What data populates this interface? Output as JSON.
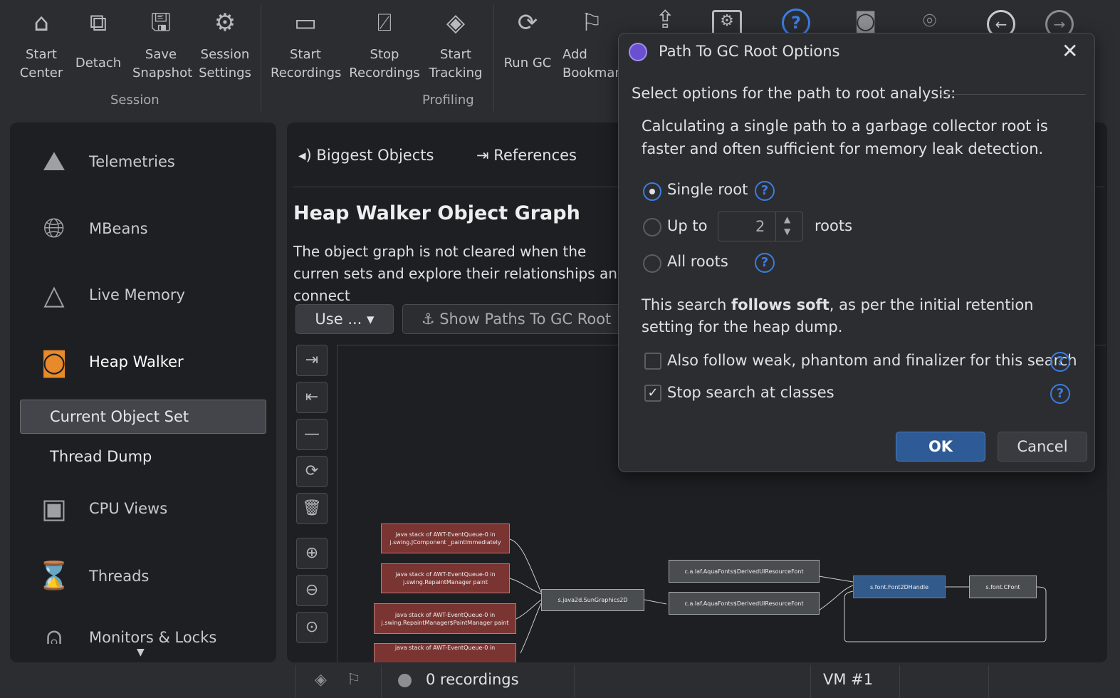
{
  "toolbar": {
    "items": [
      {
        "label": "Start\nCenter",
        "icon": "home-icon"
      },
      {
        "label": "Detach",
        "icon": "detach-icon"
      },
      {
        "label": "Save\nSnapshot",
        "icon": "save-icon"
      },
      {
        "label": "Session\nSettings",
        "icon": "gear-icon"
      },
      {
        "label": "Start\nRecordings",
        "icon": "video-icon"
      },
      {
        "label": "Stop\nRecordings",
        "icon": "video-off-icon"
      },
      {
        "label": "Start\nTracking",
        "icon": "tracking-icon"
      },
      {
        "label": "Run GC",
        "icon": "refresh-icon"
      },
      {
        "label": "Add\nBookmark",
        "icon": "bookmark-icon"
      }
    ],
    "groups": {
      "session": "Session",
      "profiling": "Profiling"
    }
  },
  "sidebar": {
    "items": [
      {
        "label": "Telemetries",
        "icon": "chart-icon"
      },
      {
        "label": "MBeans",
        "icon": "globe-icon"
      },
      {
        "label": "Live Memory",
        "icon": "shapes-icon"
      },
      {
        "label": "Heap Walker",
        "icon": "camera-icon"
      },
      {
        "label": "CPU Views",
        "icon": "cpu-icon"
      },
      {
        "label": "Threads",
        "icon": "threads-icon"
      },
      {
        "label": "Monitors & Locks",
        "icon": "lock-icon"
      }
    ],
    "subitems": [
      "Current Object Set",
      "Thread Dump"
    ]
  },
  "main": {
    "tabs": [
      "Biggest Objects",
      "References"
    ],
    "title": "Heap Walker Object Graph",
    "description": "The object graph is not cleared when the curren sets and explore their relationships and connect",
    "use_button": "Use ...",
    "show_paths_button": "Show Paths To GC Root",
    "graph": {
      "nodes": [
        "java stack of AWT-EventQueue-0 in j.swing.JComponent _paintImmediately",
        "java stack of AWT-EventQueue-0 in j.swing.RepaintManager paint",
        "java stack of AWT-EventQueue-0 in j.swing.RepaintManager$PaintManager paint",
        "java stack of AWT-EventQueue-0 in",
        "s.java2d.SunGraphics2D",
        "c.a.laf.AquaFonts$DerivedUIResourceFont",
        "c.a.laf.AquaFonts$DerivedUIResourceFont",
        "s.font.Font2DHandle",
        "s.font.CFont"
      ]
    }
  },
  "dialog": {
    "title": "Path To GC Root Options",
    "section": "Select options for the path to root analysis:",
    "intro": "Calculating a single path to a garbage collector root is faster and often sufficient for memory leak detection.",
    "options": {
      "single": "Single root",
      "upto": "Up to",
      "upto_value": "2",
      "roots": "roots",
      "all": "All roots",
      "selected": "single"
    },
    "note_pre": "This search ",
    "note_bold": "follows soft",
    "note_post": ", as per the initial retention setting for the heap dump.",
    "check_weak": {
      "label": "Also follow weak, phantom and finalizer for this search",
      "checked": false
    },
    "check_classes": {
      "label": "Stop search at classes",
      "checked": true
    },
    "ok": "OK",
    "cancel": "Cancel"
  },
  "status": {
    "recordings": "0 recordings",
    "vm": "VM #1"
  }
}
